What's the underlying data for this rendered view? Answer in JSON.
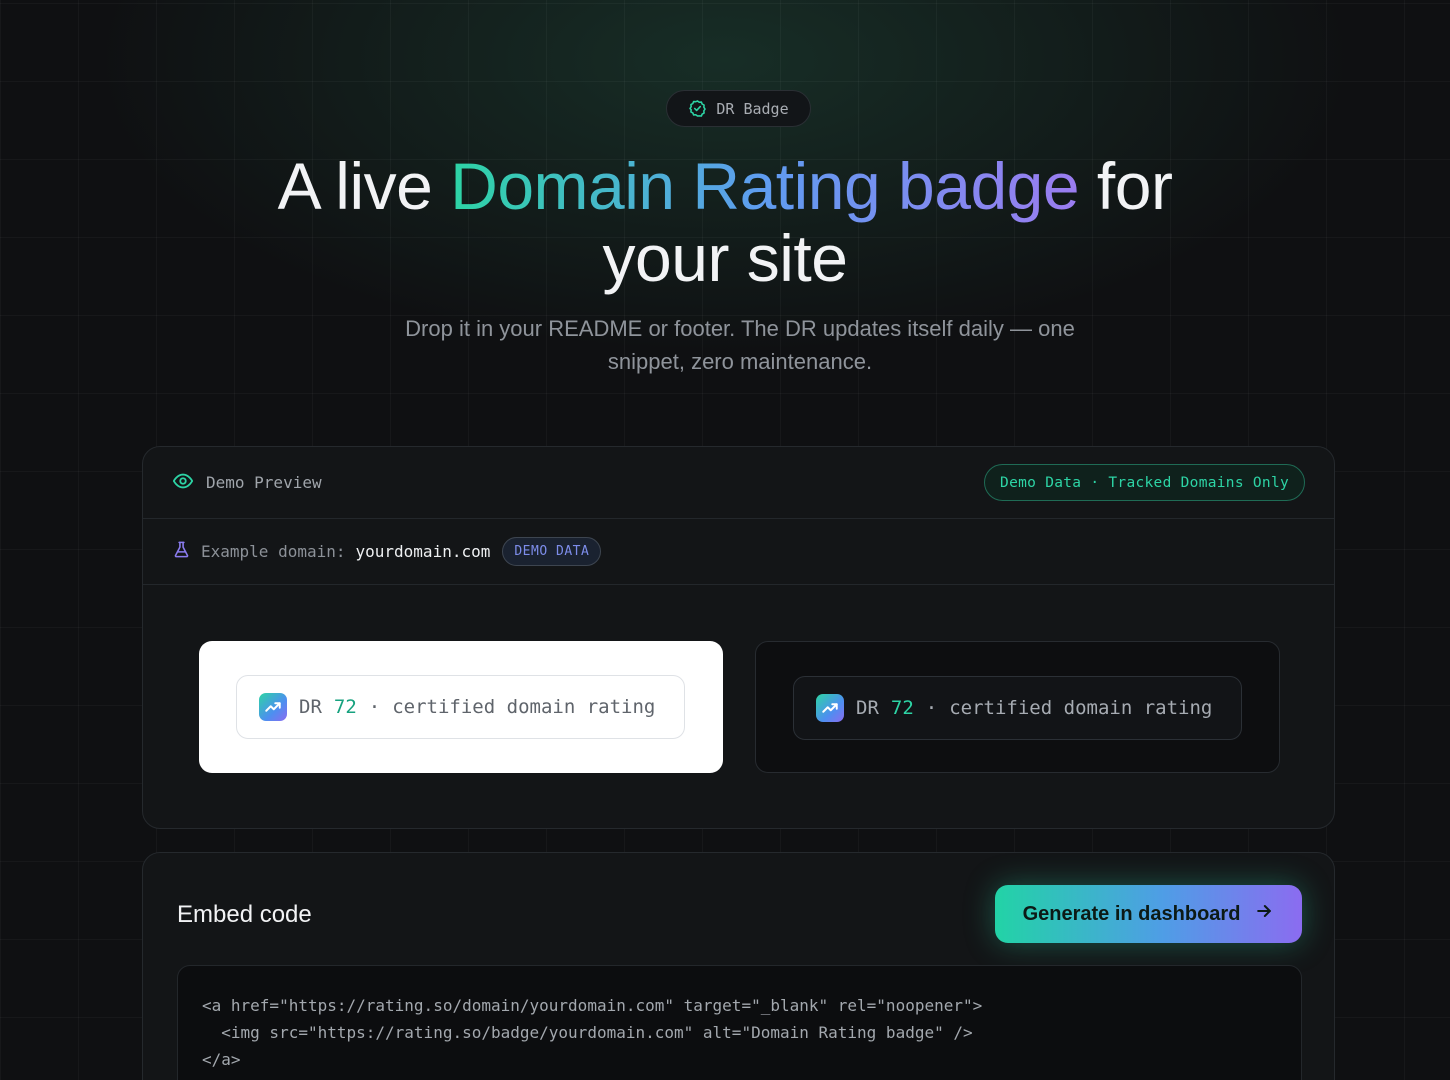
{
  "hero": {
    "pill_label": "DR Badge",
    "title_pre": "A live ",
    "title_highlight": "Domain Rating badge",
    "title_post": " for",
    "title_line2": "your site",
    "subtitle": "Drop it in your README or footer. The DR updates itself daily — one snippet, zero maintenance."
  },
  "demo_card": {
    "header_label": "Demo Preview",
    "tag": "Demo Data · Tracked Domains Only",
    "example_label": "Example domain:",
    "example_domain": "yourdomain.com",
    "demo_badge": "DEMO DATA",
    "badge_light": {
      "prefix": "DR",
      "value": "72",
      "sep": "·",
      "text": "certified domain rating"
    },
    "badge_dark": {
      "prefix": "DR",
      "value": "72",
      "sep": "·",
      "text": "certified domain rating"
    }
  },
  "embed": {
    "title": "Embed code",
    "button_label": "Generate in dashboard",
    "code_lines": [
      "<a href=\"https://rating.so/domain/yourdomain.com\" target=\"_blank\" rel=\"noopener\">",
      "  <img src=\"https://rating.so/badge/yourdomain.com\" alt=\"Domain Rating badge\" />",
      "</a>"
    ]
  },
  "colors": {
    "accent_green": "#2dd4a5",
    "accent_blue": "#5f9cf0",
    "accent_purple": "#9b7cf0",
    "background": "#0f1012"
  },
  "icons": {
    "pill": "check-circle-icon",
    "header": "eye-icon",
    "example": "flask-icon",
    "badge_logo": "trending-up-icon",
    "button": "arrow-right-icon"
  }
}
